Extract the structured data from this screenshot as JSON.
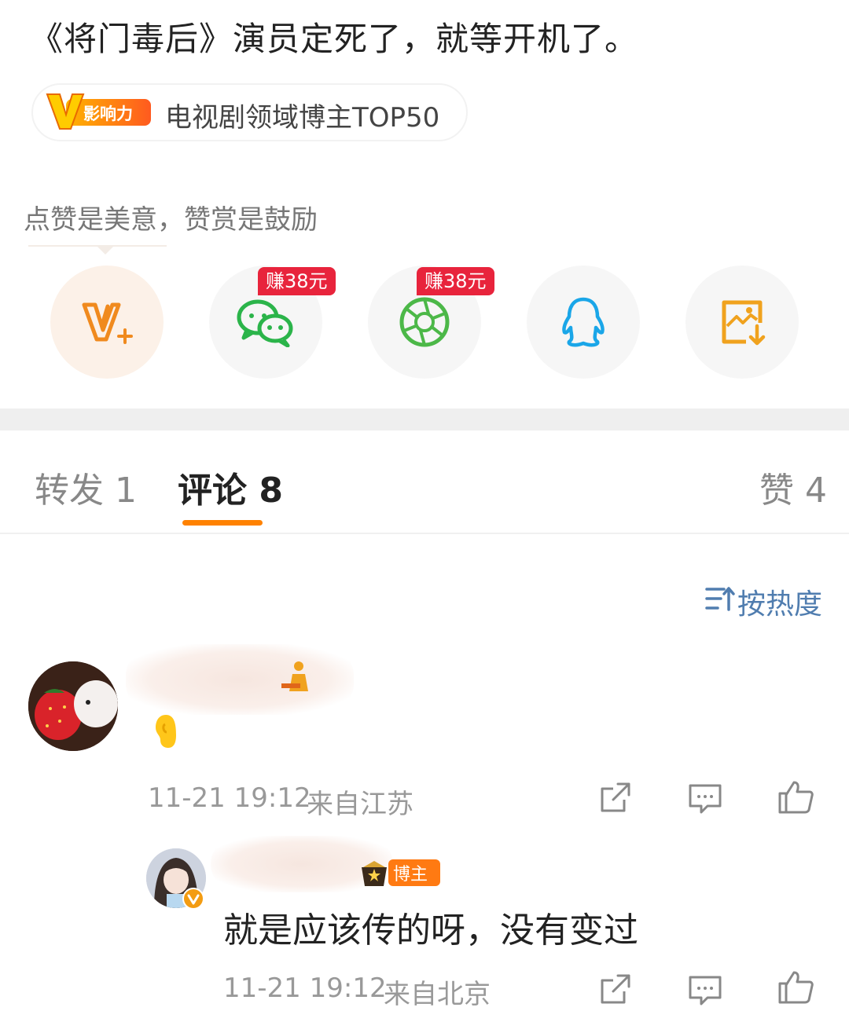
{
  "post": {
    "text": "《将门毒后》演员定死了，就等开机了。",
    "influence_badge_text": "影响力",
    "influence_label": "电视剧领域博主TOP50"
  },
  "share": {
    "hint": "点赞是美意，赞赏是鼓励",
    "earn_wechat": "赚38元",
    "earn_moments": "赚38元",
    "buttons": [
      "vplus-icon",
      "wechat-icon",
      "moments-icon",
      "qq-icon",
      "save-image-icon"
    ]
  },
  "tabs": {
    "repost": "转发 1",
    "comment": "评论 8",
    "like": "赞 4"
  },
  "sort_label": "按热度",
  "comments": [
    {
      "time": "11-21 19:12",
      "location": "来自江苏",
      "replies": [
        {
          "badge": "博主",
          "text": "就是应该传的呀，没有变过",
          "time": "11-21 19:12",
          "location": "来自北京"
        }
      ]
    }
  ],
  "colors": {
    "accent": "#ff8200",
    "link": "#507daf",
    "earn": "#e8243c",
    "wechat": "#2bb44a",
    "qq": "#1aa6e8"
  }
}
